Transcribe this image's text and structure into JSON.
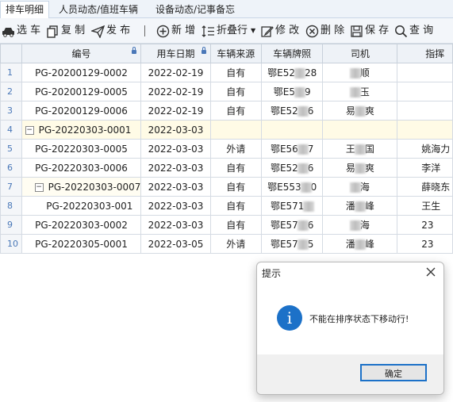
{
  "tabs": [
    {
      "label": "排车明细"
    },
    {
      "label": "人员动态/值班车辆"
    },
    {
      "label": "设备动态/记事备忘"
    }
  ],
  "toolbar": {
    "select": "选 车",
    "copy": "复 制",
    "publish": "发 布",
    "add": "新 增",
    "fold": "折叠行",
    "edit": "修 改",
    "delete": "删 除",
    "save": "保 存",
    "query": "查 询"
  },
  "columns": [
    "编号",
    "用车日期",
    "车辆来源",
    "车辆牌照",
    "司机",
    "指挥"
  ],
  "rows": [
    {
      "no": "1",
      "code": "PG-20200129-0002",
      "date": "2022-02-19",
      "source": "自有",
      "plate_a": "鄂E52",
      "plate_b": "28",
      "driver_a": "",
      "driver_b": "顺",
      "commander": ""
    },
    {
      "no": "2",
      "code": "PG-20200129-0005",
      "date": "2022-02-19",
      "source": "自有",
      "plate_a": "鄂E5",
      "plate_b": "9",
      "driver_a": "",
      "driver_b": "玉",
      "commander": ""
    },
    {
      "no": "3",
      "code": "PG-20200129-0006",
      "date": "2022-02-19",
      "source": "自有",
      "plate_a": "鄂E52",
      "plate_b": "6",
      "driver_a": "易",
      "driver_b": "爽",
      "commander": ""
    },
    {
      "no": "4",
      "code": "PG-20220303-0001",
      "date": "2022-03-03",
      "source": "",
      "plate_a": "",
      "plate_b": "",
      "driver_a": "",
      "driver_b": "",
      "commander": ""
    },
    {
      "no": "5",
      "code": "PG-20220303-0005",
      "date": "2022-03-03",
      "source": "外请",
      "plate_a": "鄂E56",
      "plate_b": "7",
      "driver_a": "王",
      "driver_b": "国",
      "commander": "姚海力"
    },
    {
      "no": "6",
      "code": "PG-20220303-0006",
      "date": "2022-03-03",
      "source": "自有",
      "plate_a": "鄂E52",
      "plate_b": "6",
      "driver_a": "易",
      "driver_b": "爽",
      "commander": "李洋"
    },
    {
      "no": "7",
      "code": "PG-20220303-0007",
      "date": "2022-03-03",
      "source": "自有",
      "plate_a": "鄂E553",
      "plate_b": "0",
      "driver_a": "",
      "driver_b": "海",
      "commander": "薛晓东"
    },
    {
      "no": "8",
      "code": "PG-20220303-001",
      "date": "2022-03-03",
      "source": "自有",
      "plate_a": "鄂E571",
      "plate_b": "",
      "driver_a": "潘",
      "driver_b": "峰",
      "commander": "王生"
    },
    {
      "no": "9",
      "code": "PG-20220303-0002",
      "date": "2022-03-03",
      "source": "自有",
      "plate_a": "鄂E57",
      "plate_b": "6",
      "driver_a": "",
      "driver_b": "海",
      "commander": "23"
    },
    {
      "no": "10",
      "code": "PG-20220305-0001",
      "date": "2022-03-05",
      "source": "外请",
      "plate_a": "鄂E57",
      "plate_b": "5",
      "driver_a": "潘",
      "driver_b": "峰",
      "commander": "23"
    }
  ],
  "dialog": {
    "title": "提示",
    "message": "不能在排序状态下移动行!",
    "ok_label": "确定",
    "icon": "info-icon"
  },
  "colors": {
    "accent": "#1c71c8",
    "row_highlight": "#fffbe6",
    "row_number": "#4a78b8"
  }
}
